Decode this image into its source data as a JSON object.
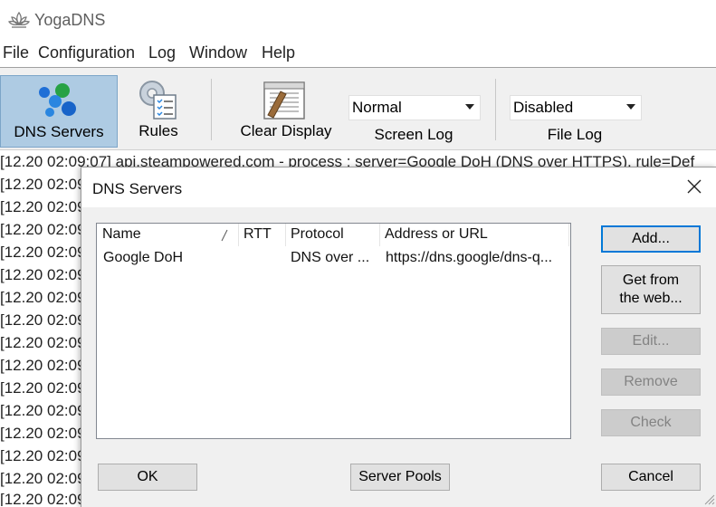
{
  "app": {
    "title": "YogaDNS"
  },
  "menu": [
    "File",
    "Configuration",
    "Log",
    "Window",
    "Help"
  ],
  "toolbar": {
    "dns_servers": "DNS Servers",
    "rules": "Rules",
    "clear_display": "Clear Display",
    "screen_log": {
      "value": "Normal",
      "label": "Screen Log"
    },
    "file_log": {
      "value": "Disabled",
      "label": "File Log"
    }
  },
  "log": {
    "first_line": "[12.20 02:09:07] api.steampowered.com - process : server=Google DoH (DNS over HTTPS), rule=Def",
    "prefix": "[12.20 02:09"
  },
  "dialog": {
    "title": "DNS Servers",
    "columns": [
      "Name",
      "RTT",
      "Protocol",
      "Address or URL"
    ],
    "rows": [
      {
        "name": "Google DoH",
        "rtt": "",
        "protocol": "DNS over ...",
        "address": "https://dns.google/dns-q..."
      }
    ],
    "buttons": {
      "add": "Add...",
      "get_from_web_1": "Get from",
      "get_from_web_2": "the web...",
      "edit": "Edit...",
      "remove": "Remove",
      "check": "Check",
      "ok": "OK",
      "server_pools": "Server Pools",
      "cancel": "Cancel"
    }
  },
  "colors": {
    "active_toolbar": "#aecbe3",
    "default_button_border": "#0078d7",
    "dialog_bg": "#f0f0f0"
  }
}
